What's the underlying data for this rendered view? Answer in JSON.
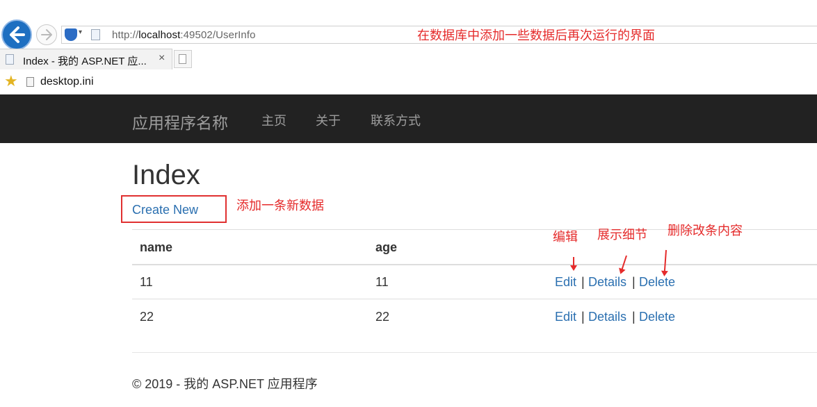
{
  "browser": {
    "url_prefix": "http://",
    "url_host": "localhost",
    "url_rest": ":49502/UserInfo",
    "tab_title": "Index - 我的 ASP.NET 应...",
    "tab_close": "×",
    "favorites": [
      "desktop.ini"
    ]
  },
  "annotations": {
    "top": "在数据库中添加一些数据后再次运行的界面",
    "create": "添加一条新数据",
    "edit": "编辑",
    "details": "展示细节",
    "delete": "删除改条内容"
  },
  "nav": {
    "brand": "应用程序名称",
    "links": [
      "主页",
      "关于",
      "联系方式"
    ]
  },
  "page": {
    "title": "Index",
    "create_link": "Create New"
  },
  "table": {
    "headers": [
      "name",
      "age"
    ],
    "rows": [
      {
        "name": "11",
        "age": "11"
      },
      {
        "name": "22",
        "age": "22"
      }
    ],
    "actions": [
      "Edit",
      "Details",
      "Delete"
    ],
    "separator": "|"
  },
  "footer": {
    "text": "© 2019 - 我的 ASP.NET 应用程序"
  },
  "colors": {
    "annotation": "#e52b2b",
    "navbar_bg": "#222222",
    "link": "#2a6fb0"
  }
}
